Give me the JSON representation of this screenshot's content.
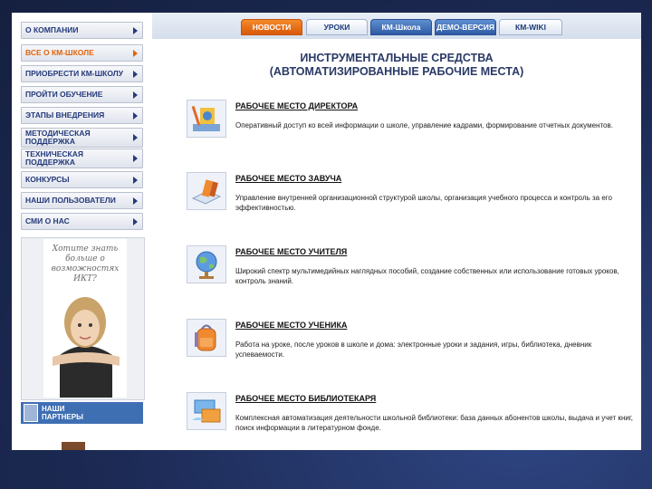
{
  "sidebar": {
    "items": [
      {
        "label": "О КОМПАНИИ"
      },
      {
        "label": "ВСЕ О КМ-ШКОЛЕ"
      },
      {
        "label": "ПРИОБРЕСТИ КМ-ШКОЛУ"
      },
      {
        "label": "ПРОЙТИ ОБУЧЕНИЕ"
      },
      {
        "label": "ЭТАПЫ ВНЕДРЕНИЯ"
      },
      {
        "label": "МЕТОДИЧЕСКАЯ ПОДДЕРЖКА"
      },
      {
        "label": "ТЕХНИЧЕСКАЯ ПОДДЕРЖКА"
      },
      {
        "label": "КОНКУРСЫ"
      },
      {
        "label": "НАШИ ПОЛЬЗОВАТЕЛИ"
      },
      {
        "label": "СМИ О НАС"
      }
    ],
    "promo_text": "Хотите знать больше о возможностях ИКТ?",
    "partners_label": "НАШИ ПАРТНЕРЫ"
  },
  "topnav": {
    "tabs": [
      {
        "label": "НОВОСТИ"
      },
      {
        "label": "УРОКИ"
      },
      {
        "label": "КМ-Школа"
      },
      {
        "label": "ДЕМО-ВЕРСИЯ"
      },
      {
        "label": "КМ-WIKI"
      }
    ]
  },
  "main": {
    "title_line1": "ИНСТРУМЕНТАЛЬНЫЕ СРЕДСТВА",
    "title_line2": "(АВТОМАТИЗИРОВАННЫЕ РАБОЧИЕ МЕСТА)",
    "workplaces": [
      {
        "title": "РАБОЧЕЕ МЕСТО ДИРЕКТОРА",
        "description": "Оперативный доступ ко всей информации о школе, управление кадрами, формирование отчетных документов.",
        "icon": "director-icon"
      },
      {
        "title": "РАБОЧЕЕ МЕСТО ЗАВУЧА",
        "description": "Управление внутренней организационной структурой школы, организация учебного процесса и контроль за его эффективностью.",
        "icon": "books-icon"
      },
      {
        "title": "РАБОЧЕЕ МЕСТО УЧИТЕЛЯ",
        "description": "Широкий спектр мультимедийных наглядных пособий, создание собственных или использование готовых уроков, контроль знаний.",
        "icon": "globe-icon"
      },
      {
        "title": "РАБОЧЕЕ МЕСТО УЧЕНИКА",
        "description": "Работа на уроке, после уроков в школе и дома: электронные уроки и задания, игры, библиотека, дневник успеваемости.",
        "icon": "backpack-icon"
      },
      {
        "title": "РАБОЧЕЕ МЕСТО БИБЛИОТЕКАРЯ",
        "description": "Комплексная автоматизация деятельности школьной библиотеки: база данных абонентов школы, выдача и учет книг, поиск информации в литературном фонде.",
        "icon": "library-icon"
      }
    ]
  }
}
